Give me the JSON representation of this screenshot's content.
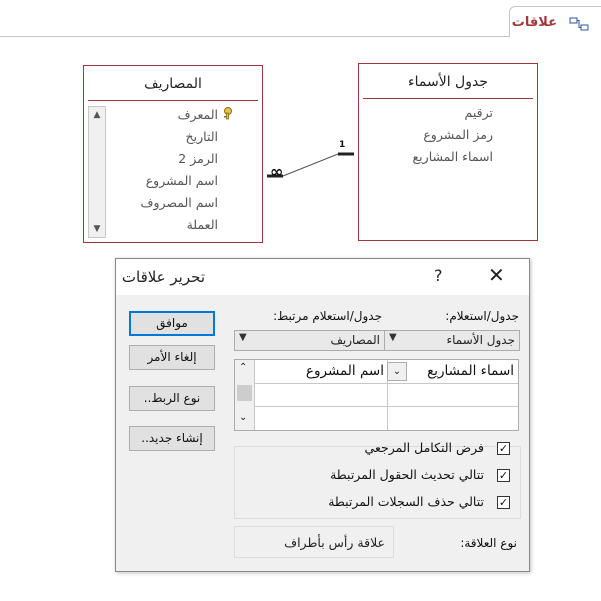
{
  "tab": {
    "label": "علاقات",
    "icon": "relationships-icon"
  },
  "tables": {
    "expenses": {
      "title": "المصاريف",
      "fields": [
        "المعرف",
        "التاريخ",
        "الرمز 2",
        "اسم المشروع",
        "اسم المصروف",
        "العملة"
      ],
      "key_field_icon": "primary-key-icon"
    },
    "names": {
      "title": "جدول الأسماء",
      "fields": [
        "ترقيم",
        "رمز المشروع",
        "اسماء المشاريع"
      ]
    }
  },
  "relationship": {
    "one_label": "1",
    "many_label": "∞"
  },
  "dialog": {
    "title": "تحرير علاقات",
    "help": "?",
    "close": "✕",
    "buttons": {
      "ok": "موافق",
      "cancel": "إلغاء الأمر",
      "join_type": "نوع الربط..",
      "create_new": "إنشاء جديد.."
    },
    "table_query_label": "جدول/استعلام:",
    "related_query_label": "جدول/استعلام مرتبط:",
    "table_query_value": "جدول الأسماء",
    "related_query_value": "المصاريف",
    "grid": {
      "left_field": "اسماء المشاريع",
      "right_field": "اسم المشروع"
    },
    "checkboxes": [
      {
        "label": "فرض التكامل المرجعي",
        "checked": true
      },
      {
        "label": "تتالي تحديث الحقول المرتبطة",
        "checked": true
      },
      {
        "label": "تتالي حذف السجلات المرتبطة",
        "checked": true
      }
    ],
    "relation_type_label": "نوع العلاقة:",
    "relation_type_value": "علاقة رأس بأطراف"
  }
}
